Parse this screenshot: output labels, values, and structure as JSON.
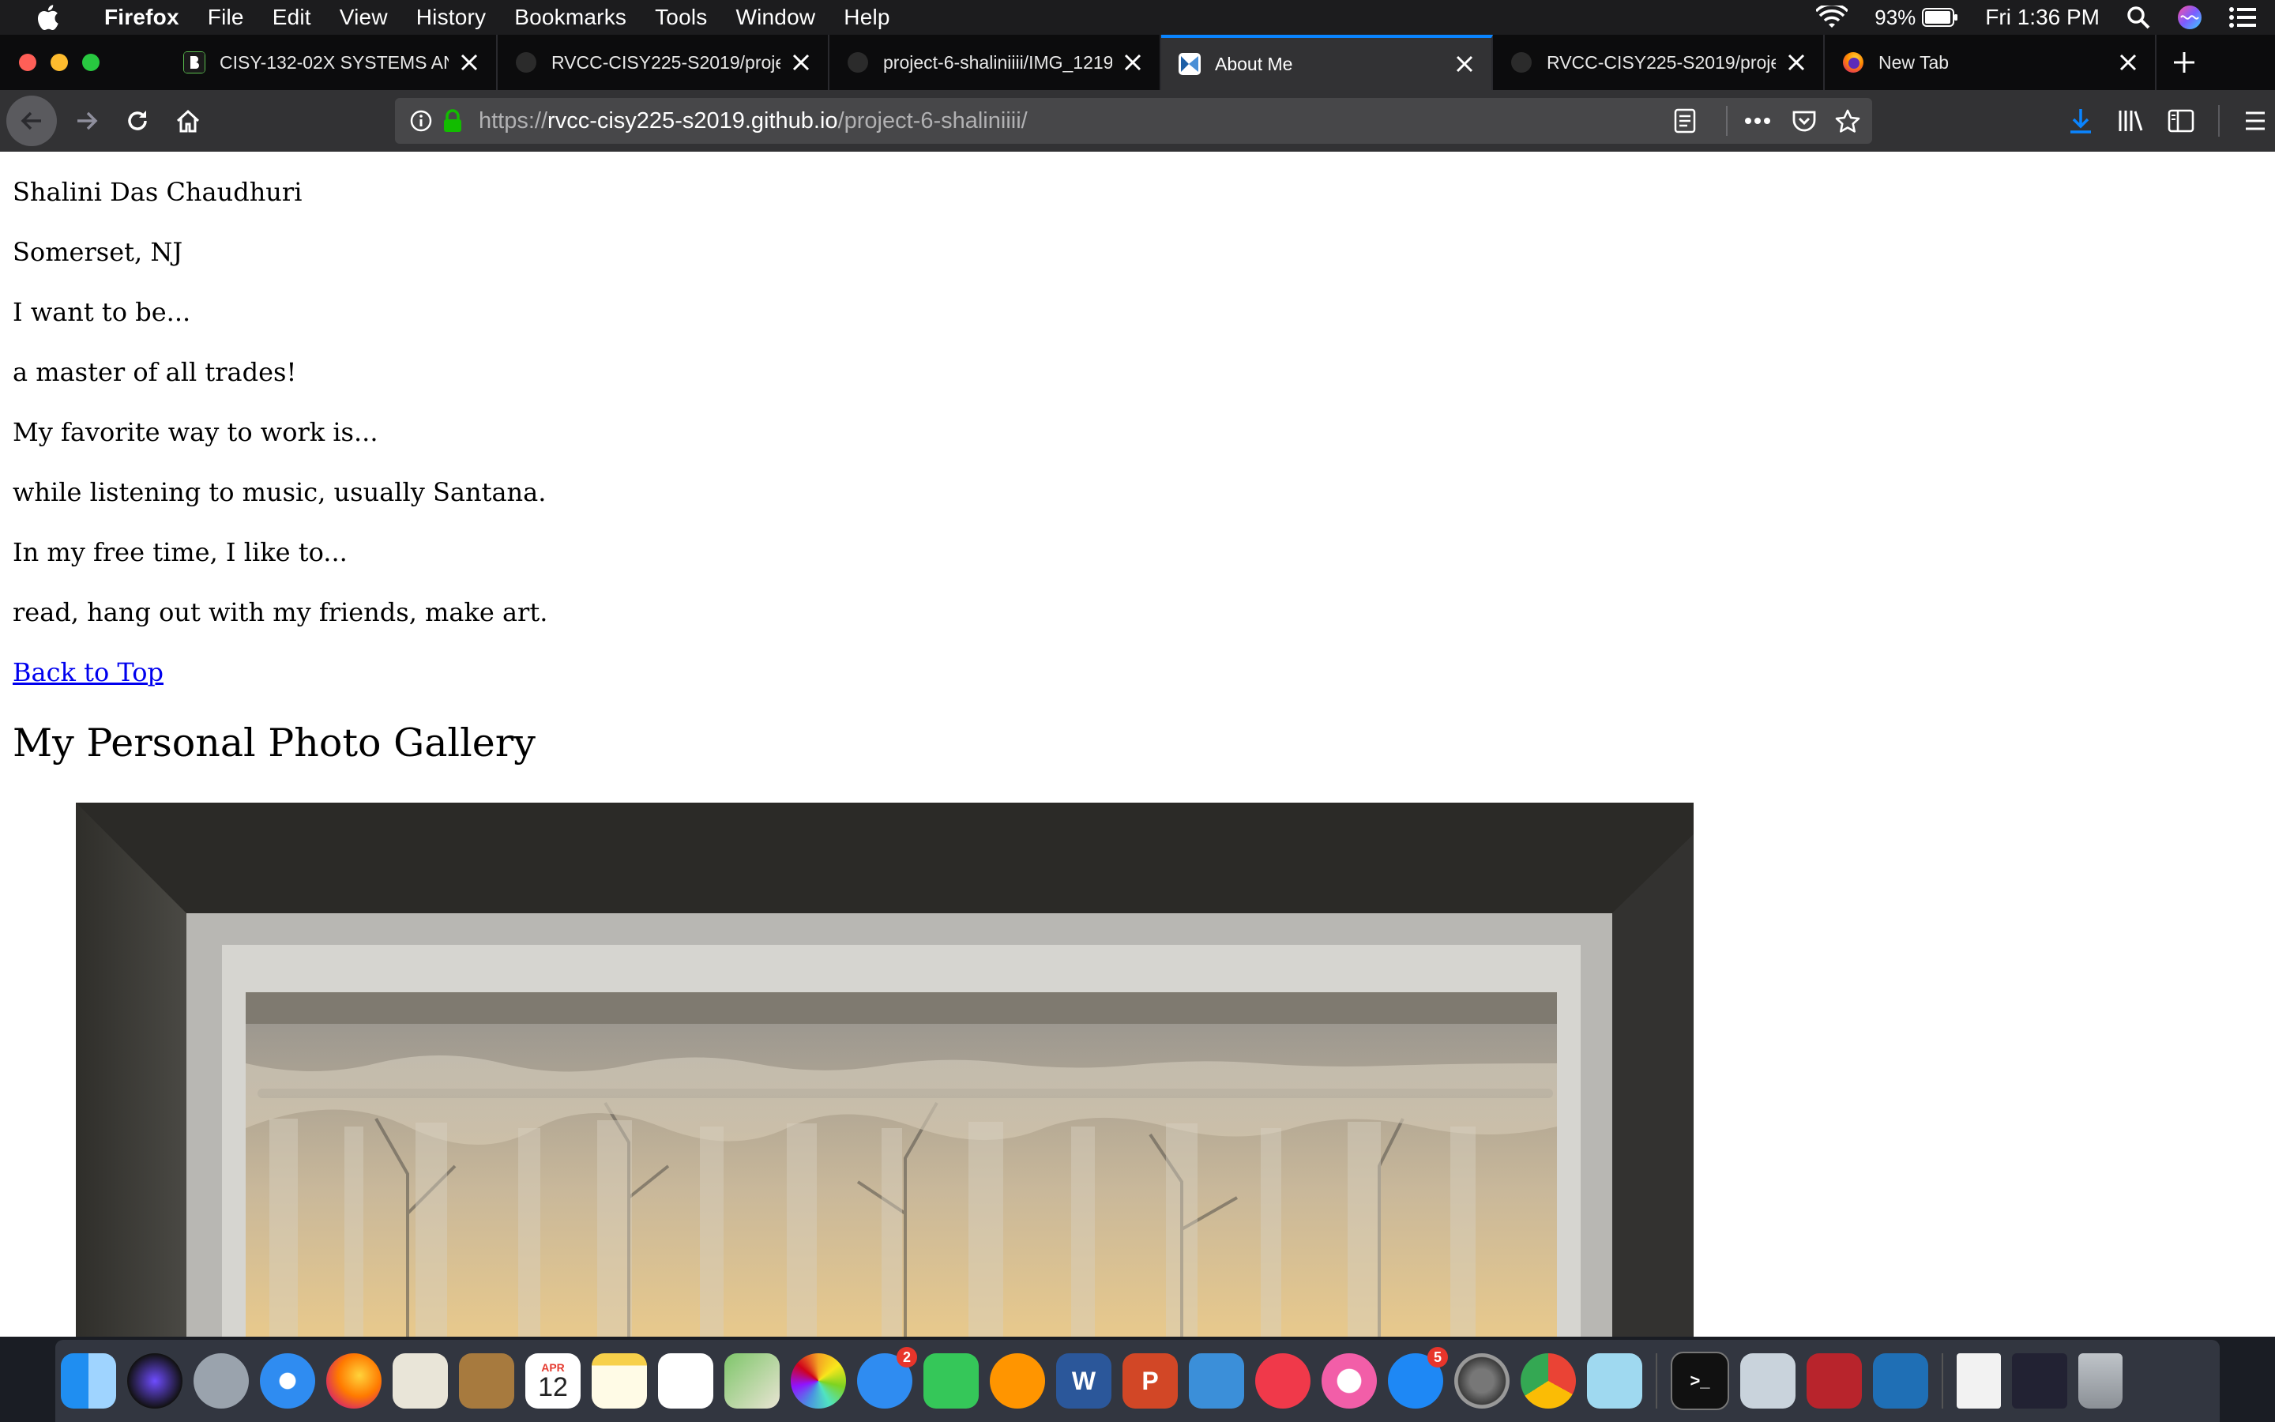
{
  "menubar": {
    "app_name": "Firefox",
    "items": [
      "File",
      "Edit",
      "View",
      "History",
      "Bookmarks",
      "Tools",
      "Window",
      "Help"
    ],
    "battery": "93%",
    "clock": "Fri 1:36 PM"
  },
  "tabs": [
    {
      "title": "CISY-132-02X SYSTEMS AN",
      "favicon": "blackboard-icon",
      "active": false
    },
    {
      "title": "RVCC-CISY225-S2019/proje",
      "favicon": "github-icon",
      "active": false
    },
    {
      "title": "project-6-shaliniiii/IMG_1219",
      "favicon": "github-icon",
      "active": false
    },
    {
      "title": "About Me",
      "favicon": "site-icon",
      "active": true
    },
    {
      "title": "RVCC-CISY225-S2019/proje",
      "favicon": "github-icon",
      "active": false
    },
    {
      "title": "New Tab",
      "favicon": "firefox-icon",
      "active": false
    }
  ],
  "url": {
    "scheme": "https://",
    "host": "rvcc-cisy225-s2019.github.io",
    "path": "/project-6-shaliniiii/"
  },
  "page": {
    "lines": [
      "Shalini Das Chaudhuri",
      "Somerset, NJ",
      "I want to be...",
      "a master of all trades!",
      "My favorite way to work is...",
      "while listening to music, usually Santana.",
      "In my free time, I like to...",
      "read, hang out with my friends, make art."
    ],
    "back_link": "Back to Top",
    "gallery_heading": "My Personal Photo Gallery"
  },
  "dock": {
    "calendar_month": "APR",
    "calendar_day": "12",
    "messages_badge": "2",
    "appstore_badge": "5"
  },
  "colors": {
    "accent": "#0a84ff",
    "link": "#0000ee",
    "secure_lock": "#12bc00"
  }
}
